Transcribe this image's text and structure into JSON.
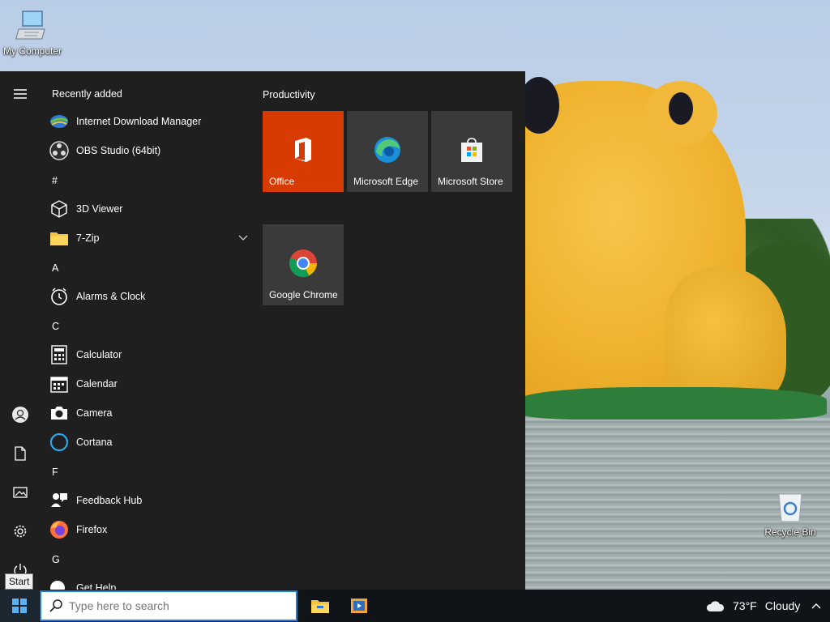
{
  "desktop": {
    "icons": [
      {
        "label": "My Computer",
        "icon": "computer-icon"
      },
      {
        "label": "Recycle Bin",
        "icon": "recycle-bin-icon"
      }
    ]
  },
  "start_menu": {
    "recent_title": "Recently added",
    "apps": [
      {
        "label": "Internet Download Manager",
        "icon": "idm-icon"
      },
      {
        "label": "OBS Studio (64bit)",
        "icon": "obs-icon"
      },
      {
        "heading": "#"
      },
      {
        "label": "3D Viewer",
        "icon": "cube-icon"
      },
      {
        "label": "7-Zip",
        "icon": "folder-icon",
        "expandable": true
      },
      {
        "heading": "A"
      },
      {
        "label": "Alarms & Clock",
        "icon": "clock-icon"
      },
      {
        "heading": "C"
      },
      {
        "label": "Calculator",
        "icon": "calculator-icon"
      },
      {
        "label": "Calendar",
        "icon": "calendar-icon"
      },
      {
        "label": "Camera",
        "icon": "camera-icon"
      },
      {
        "label": "Cortana",
        "icon": "cortana-icon"
      },
      {
        "heading": "F"
      },
      {
        "label": "Feedback Hub",
        "icon": "feedback-icon"
      },
      {
        "label": "Firefox",
        "icon": "firefox-icon"
      },
      {
        "heading": "G"
      },
      {
        "label": "Get Help",
        "icon": "help-icon"
      }
    ],
    "group_title": "Productivity",
    "tiles": [
      {
        "label": "Office",
        "icon": "office-icon",
        "color": "#d83b01"
      },
      {
        "label": "Microsoft Edge",
        "icon": "edge-icon",
        "color": "#3a3a3a"
      },
      {
        "label": "Microsoft Store",
        "icon": "store-icon",
        "color": "#3a3a3a"
      },
      {
        "label": "Google Chrome",
        "icon": "chrome-icon",
        "color": "#3a3a3a"
      }
    ],
    "rail": [
      "hamburger-icon",
      "user-icon",
      "document-icon",
      "pictures-icon",
      "settings-icon",
      "power-icon"
    ]
  },
  "taskbar": {
    "start_tooltip": "Start",
    "search_placeholder": "Type here to search",
    "pinned": [
      "file-explorer-icon",
      "media-player-icon"
    ],
    "weather": {
      "temp": "73°F",
      "condition": "Cloudy"
    }
  },
  "colors": {
    "accent": "#1d7fd8",
    "office": "#d83b01",
    "menu_bg": "#1f1f1f",
    "taskbar_bg": "#101418"
  }
}
